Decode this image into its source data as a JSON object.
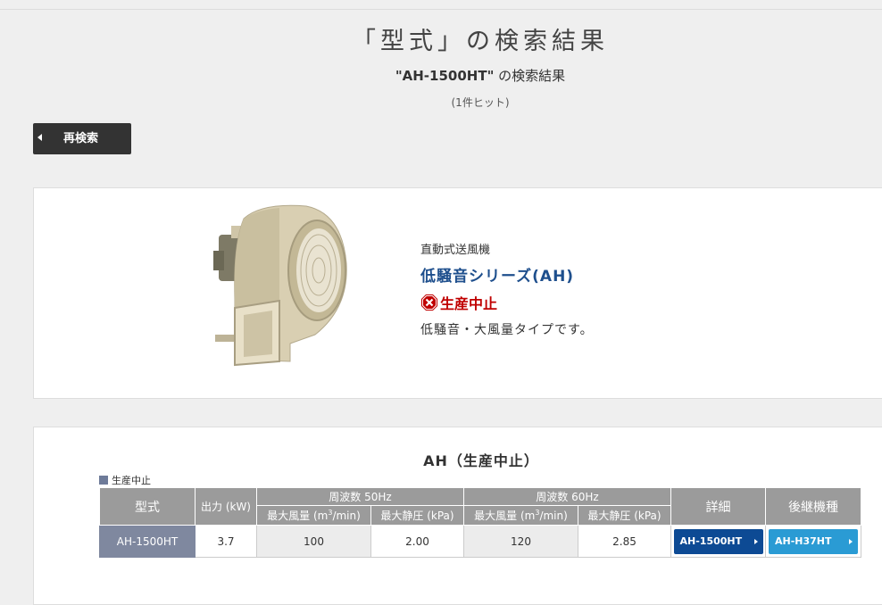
{
  "page": {
    "title": "「型式」の検索結果",
    "query": "\"AH-1500HT\"",
    "query_suffix": " の検索結果",
    "hit_count": "(1件ヒット)",
    "research_button": "再検索"
  },
  "product": {
    "category": "直動式送風機",
    "series": "低騒音シリーズ(AH)",
    "status": "生産中止",
    "description": "低騒音・大風量タイプです。"
  },
  "spec_table": {
    "title": "AH（生産中止）",
    "legend": "生産中止",
    "headers": {
      "model": "型式",
      "output": "出力 (kW)",
      "freq50": "周波数 50Hz",
      "freq60": "周波数 60Hz",
      "max_flow_prefix": "最大風量 (m",
      "max_flow_sup": "3",
      "max_flow_suffix": "/min)",
      "max_pressure": "最大静圧 (kPa)",
      "detail": "詳細",
      "successor": "後継機種"
    },
    "rows": [
      {
        "model": "AH-1500HT",
        "output": "3.7",
        "flow50": "100",
        "pressure50": "2.00",
        "flow60": "120",
        "pressure60": "2.85",
        "detail_button": "AH-1500HT",
        "successor_button": "AH-H37HT"
      }
    ]
  },
  "colors": {
    "detail_button": "#0d4a94",
    "successor_button": "#2a9bd4",
    "series_text": "#1e4f8d",
    "discontinued_text": "#c00000"
  }
}
